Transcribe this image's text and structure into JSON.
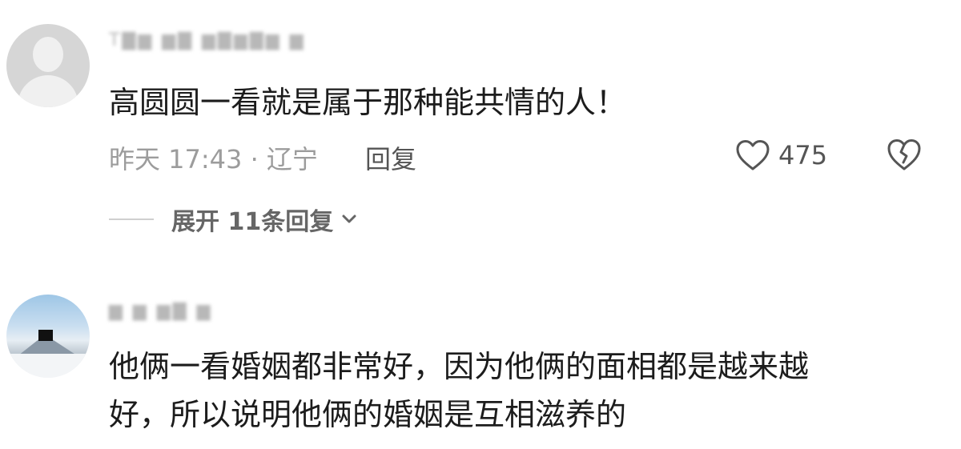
{
  "comments": [
    {
      "username": "T▇▆ ▆▇ ▆▇▆▇▆ ▆",
      "content": "高圆圆一看就是属于那种能共情的人！",
      "time_location": "昨天 17:43 · 辽宁",
      "reply_label": "回复",
      "like_count": "475",
      "expand_label": "展开 11条回复"
    },
    {
      "username": "▆ ▆ ▆▇ ▆",
      "content_line1": "他俩一看婚姻都非常好，因为他俩的面相都是越来越",
      "content_line2": "好，所以说明他俩的婚姻是互相滋养的"
    }
  ],
  "icons": {
    "like": "heart-outline-icon",
    "dislike": "broken-heart-icon",
    "expand": "chevron-down-icon"
  }
}
